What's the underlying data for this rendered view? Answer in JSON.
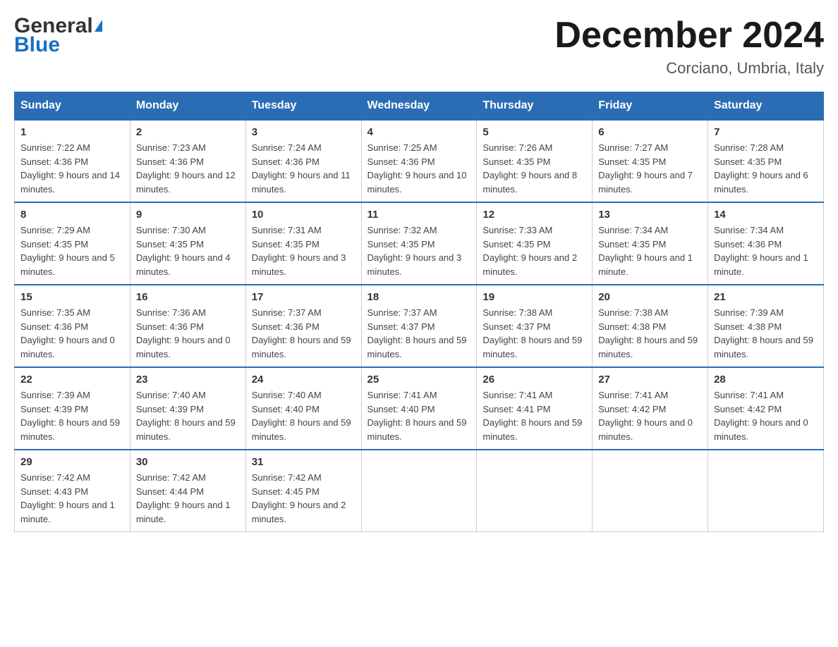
{
  "header": {
    "logo_general": "General",
    "logo_blue": "Blue",
    "month_title": "December 2024",
    "location": "Corciano, Umbria, Italy"
  },
  "days_of_week": [
    "Sunday",
    "Monday",
    "Tuesday",
    "Wednesday",
    "Thursday",
    "Friday",
    "Saturday"
  ],
  "weeks": [
    {
      "days": [
        {
          "date": "1",
          "sunrise": "7:22 AM",
          "sunset": "4:36 PM",
          "daylight": "9 hours and 14 minutes."
        },
        {
          "date": "2",
          "sunrise": "7:23 AM",
          "sunset": "4:36 PM",
          "daylight": "9 hours and 12 minutes."
        },
        {
          "date": "3",
          "sunrise": "7:24 AM",
          "sunset": "4:36 PM",
          "daylight": "9 hours and 11 minutes."
        },
        {
          "date": "4",
          "sunrise": "7:25 AM",
          "sunset": "4:36 PM",
          "daylight": "9 hours and 10 minutes."
        },
        {
          "date": "5",
          "sunrise": "7:26 AM",
          "sunset": "4:35 PM",
          "daylight": "9 hours and 8 minutes."
        },
        {
          "date": "6",
          "sunrise": "7:27 AM",
          "sunset": "4:35 PM",
          "daylight": "9 hours and 7 minutes."
        },
        {
          "date": "7",
          "sunrise": "7:28 AM",
          "sunset": "4:35 PM",
          "daylight": "9 hours and 6 minutes."
        }
      ]
    },
    {
      "days": [
        {
          "date": "8",
          "sunrise": "7:29 AM",
          "sunset": "4:35 PM",
          "daylight": "9 hours and 5 minutes."
        },
        {
          "date": "9",
          "sunrise": "7:30 AM",
          "sunset": "4:35 PM",
          "daylight": "9 hours and 4 minutes."
        },
        {
          "date": "10",
          "sunrise": "7:31 AM",
          "sunset": "4:35 PM",
          "daylight": "9 hours and 3 minutes."
        },
        {
          "date": "11",
          "sunrise": "7:32 AM",
          "sunset": "4:35 PM",
          "daylight": "9 hours and 3 minutes."
        },
        {
          "date": "12",
          "sunrise": "7:33 AM",
          "sunset": "4:35 PM",
          "daylight": "9 hours and 2 minutes."
        },
        {
          "date": "13",
          "sunrise": "7:34 AM",
          "sunset": "4:35 PM",
          "daylight": "9 hours and 1 minute."
        },
        {
          "date": "14",
          "sunrise": "7:34 AM",
          "sunset": "4:36 PM",
          "daylight": "9 hours and 1 minute."
        }
      ]
    },
    {
      "days": [
        {
          "date": "15",
          "sunrise": "7:35 AM",
          "sunset": "4:36 PM",
          "daylight": "9 hours and 0 minutes."
        },
        {
          "date": "16",
          "sunrise": "7:36 AM",
          "sunset": "4:36 PM",
          "daylight": "9 hours and 0 minutes."
        },
        {
          "date": "17",
          "sunrise": "7:37 AM",
          "sunset": "4:36 PM",
          "daylight": "8 hours and 59 minutes."
        },
        {
          "date": "18",
          "sunrise": "7:37 AM",
          "sunset": "4:37 PM",
          "daylight": "8 hours and 59 minutes."
        },
        {
          "date": "19",
          "sunrise": "7:38 AM",
          "sunset": "4:37 PM",
          "daylight": "8 hours and 59 minutes."
        },
        {
          "date": "20",
          "sunrise": "7:38 AM",
          "sunset": "4:38 PM",
          "daylight": "8 hours and 59 minutes."
        },
        {
          "date": "21",
          "sunrise": "7:39 AM",
          "sunset": "4:38 PM",
          "daylight": "8 hours and 59 minutes."
        }
      ]
    },
    {
      "days": [
        {
          "date": "22",
          "sunrise": "7:39 AM",
          "sunset": "4:39 PM",
          "daylight": "8 hours and 59 minutes."
        },
        {
          "date": "23",
          "sunrise": "7:40 AM",
          "sunset": "4:39 PM",
          "daylight": "8 hours and 59 minutes."
        },
        {
          "date": "24",
          "sunrise": "7:40 AM",
          "sunset": "4:40 PM",
          "daylight": "8 hours and 59 minutes."
        },
        {
          "date": "25",
          "sunrise": "7:41 AM",
          "sunset": "4:40 PM",
          "daylight": "8 hours and 59 minutes."
        },
        {
          "date": "26",
          "sunrise": "7:41 AM",
          "sunset": "4:41 PM",
          "daylight": "8 hours and 59 minutes."
        },
        {
          "date": "27",
          "sunrise": "7:41 AM",
          "sunset": "4:42 PM",
          "daylight": "9 hours and 0 minutes."
        },
        {
          "date": "28",
          "sunrise": "7:41 AM",
          "sunset": "4:42 PM",
          "daylight": "9 hours and 0 minutes."
        }
      ]
    },
    {
      "days": [
        {
          "date": "29",
          "sunrise": "7:42 AM",
          "sunset": "4:43 PM",
          "daylight": "9 hours and 1 minute."
        },
        {
          "date": "30",
          "sunrise": "7:42 AM",
          "sunset": "4:44 PM",
          "daylight": "9 hours and 1 minute."
        },
        {
          "date": "31",
          "sunrise": "7:42 AM",
          "sunset": "4:45 PM",
          "daylight": "9 hours and 2 minutes."
        },
        null,
        null,
        null,
        null
      ]
    }
  ],
  "labels": {
    "sunrise_prefix": "Sunrise: ",
    "sunset_prefix": "Sunset: ",
    "daylight_prefix": "Daylight: "
  }
}
